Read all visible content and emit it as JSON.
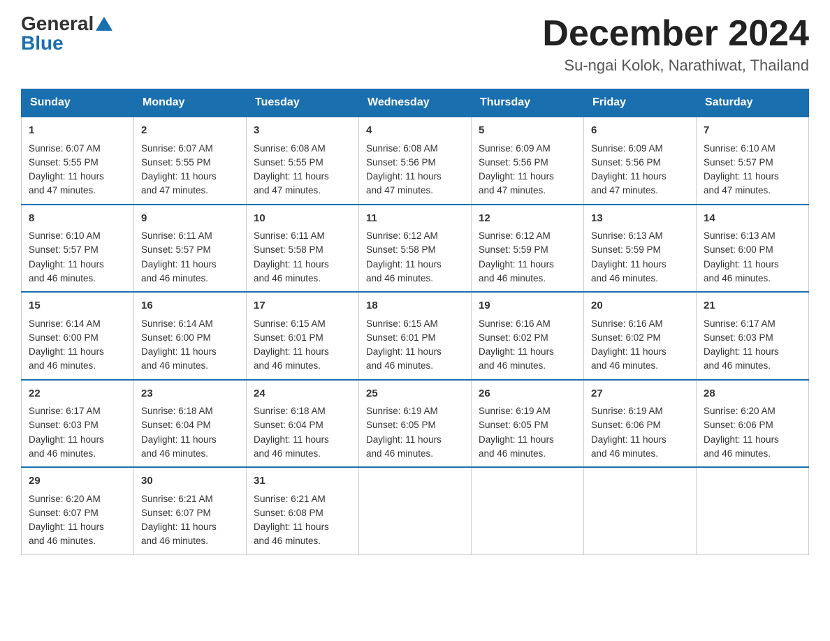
{
  "header": {
    "logo_general": "General",
    "logo_blue": "Blue",
    "month_title": "December 2024",
    "location": "Su-ngai Kolok, Narathiwat, Thailand"
  },
  "days_of_week": [
    "Sunday",
    "Monday",
    "Tuesday",
    "Wednesday",
    "Thursday",
    "Friday",
    "Saturday"
  ],
  "weeks": [
    [
      {
        "day": "1",
        "sunrise": "6:07 AM",
        "sunset": "5:55 PM",
        "daylight": "11 hours and 47 minutes."
      },
      {
        "day": "2",
        "sunrise": "6:07 AM",
        "sunset": "5:55 PM",
        "daylight": "11 hours and 47 minutes."
      },
      {
        "day": "3",
        "sunrise": "6:08 AM",
        "sunset": "5:55 PM",
        "daylight": "11 hours and 47 minutes."
      },
      {
        "day": "4",
        "sunrise": "6:08 AM",
        "sunset": "5:56 PM",
        "daylight": "11 hours and 47 minutes."
      },
      {
        "day": "5",
        "sunrise": "6:09 AM",
        "sunset": "5:56 PM",
        "daylight": "11 hours and 47 minutes."
      },
      {
        "day": "6",
        "sunrise": "6:09 AM",
        "sunset": "5:56 PM",
        "daylight": "11 hours and 47 minutes."
      },
      {
        "day": "7",
        "sunrise": "6:10 AM",
        "sunset": "5:57 PM",
        "daylight": "11 hours and 47 minutes."
      }
    ],
    [
      {
        "day": "8",
        "sunrise": "6:10 AM",
        "sunset": "5:57 PM",
        "daylight": "11 hours and 46 minutes."
      },
      {
        "day": "9",
        "sunrise": "6:11 AM",
        "sunset": "5:57 PM",
        "daylight": "11 hours and 46 minutes."
      },
      {
        "day": "10",
        "sunrise": "6:11 AM",
        "sunset": "5:58 PM",
        "daylight": "11 hours and 46 minutes."
      },
      {
        "day": "11",
        "sunrise": "6:12 AM",
        "sunset": "5:58 PM",
        "daylight": "11 hours and 46 minutes."
      },
      {
        "day": "12",
        "sunrise": "6:12 AM",
        "sunset": "5:59 PM",
        "daylight": "11 hours and 46 minutes."
      },
      {
        "day": "13",
        "sunrise": "6:13 AM",
        "sunset": "5:59 PM",
        "daylight": "11 hours and 46 minutes."
      },
      {
        "day": "14",
        "sunrise": "6:13 AM",
        "sunset": "6:00 PM",
        "daylight": "11 hours and 46 minutes."
      }
    ],
    [
      {
        "day": "15",
        "sunrise": "6:14 AM",
        "sunset": "6:00 PM",
        "daylight": "11 hours and 46 minutes."
      },
      {
        "day": "16",
        "sunrise": "6:14 AM",
        "sunset": "6:00 PM",
        "daylight": "11 hours and 46 minutes."
      },
      {
        "day": "17",
        "sunrise": "6:15 AM",
        "sunset": "6:01 PM",
        "daylight": "11 hours and 46 minutes."
      },
      {
        "day": "18",
        "sunrise": "6:15 AM",
        "sunset": "6:01 PM",
        "daylight": "11 hours and 46 minutes."
      },
      {
        "day": "19",
        "sunrise": "6:16 AM",
        "sunset": "6:02 PM",
        "daylight": "11 hours and 46 minutes."
      },
      {
        "day": "20",
        "sunrise": "6:16 AM",
        "sunset": "6:02 PM",
        "daylight": "11 hours and 46 minutes."
      },
      {
        "day": "21",
        "sunrise": "6:17 AM",
        "sunset": "6:03 PM",
        "daylight": "11 hours and 46 minutes."
      }
    ],
    [
      {
        "day": "22",
        "sunrise": "6:17 AM",
        "sunset": "6:03 PM",
        "daylight": "11 hours and 46 minutes."
      },
      {
        "day": "23",
        "sunrise": "6:18 AM",
        "sunset": "6:04 PM",
        "daylight": "11 hours and 46 minutes."
      },
      {
        "day": "24",
        "sunrise": "6:18 AM",
        "sunset": "6:04 PM",
        "daylight": "11 hours and 46 minutes."
      },
      {
        "day": "25",
        "sunrise": "6:19 AM",
        "sunset": "6:05 PM",
        "daylight": "11 hours and 46 minutes."
      },
      {
        "day": "26",
        "sunrise": "6:19 AM",
        "sunset": "6:05 PM",
        "daylight": "11 hours and 46 minutes."
      },
      {
        "day": "27",
        "sunrise": "6:19 AM",
        "sunset": "6:06 PM",
        "daylight": "11 hours and 46 minutes."
      },
      {
        "day": "28",
        "sunrise": "6:20 AM",
        "sunset": "6:06 PM",
        "daylight": "11 hours and 46 minutes."
      }
    ],
    [
      {
        "day": "29",
        "sunrise": "6:20 AM",
        "sunset": "6:07 PM",
        "daylight": "11 hours and 46 minutes."
      },
      {
        "day": "30",
        "sunrise": "6:21 AM",
        "sunset": "6:07 PM",
        "daylight": "11 hours and 46 minutes."
      },
      {
        "day": "31",
        "sunrise": "6:21 AM",
        "sunset": "6:08 PM",
        "daylight": "11 hours and 46 minutes."
      },
      null,
      null,
      null,
      null
    ]
  ],
  "labels": {
    "sunrise": "Sunrise:",
    "sunset": "Sunset:",
    "daylight": "Daylight:"
  }
}
